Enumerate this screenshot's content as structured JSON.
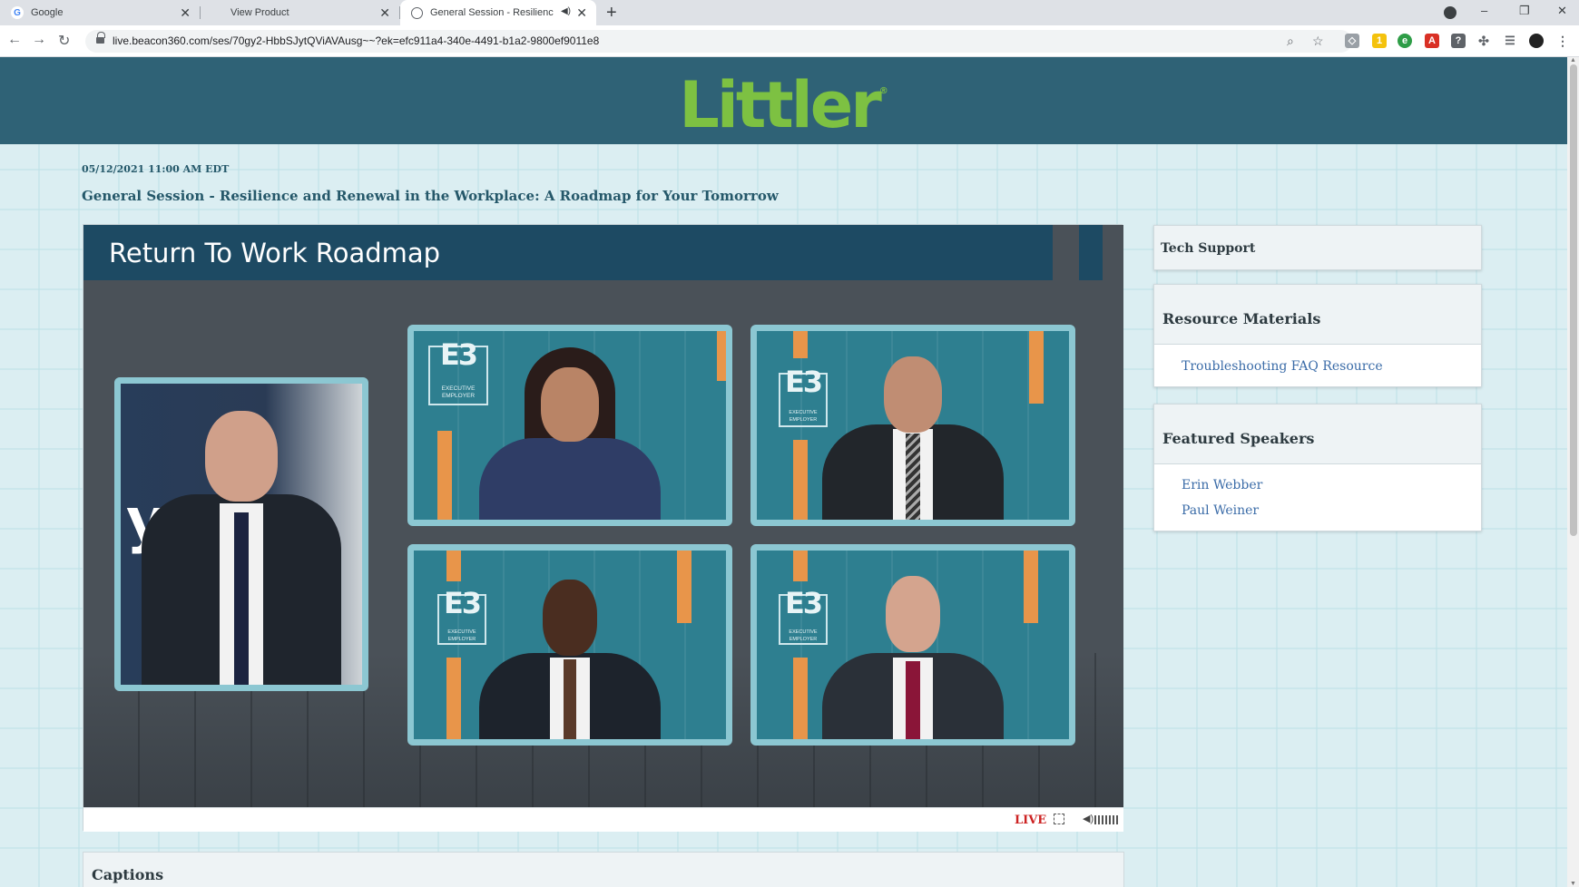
{
  "browser": {
    "tabs": [
      {
        "title": "Google",
        "favicon": "google-g-icon",
        "active": false
      },
      {
        "title": "View Product",
        "favicon": "none",
        "active": false
      },
      {
        "title": "General Session - Resilience",
        "favicon": "globe-icon",
        "active": true,
        "audio": true
      }
    ],
    "new_tab_glyph": "+",
    "url": "live.beacon360.com/ses/70gy2-HbbSJytQViAVAusg~~?ek=efc911a4-340e-4491-b1a2-9800ef9011e8",
    "window_controls": {
      "minimize": "–",
      "restore": "❐",
      "close": "✕"
    }
  },
  "header": {
    "logo_text": "Littler",
    "logo_mark": "®",
    "brand_color": "#7dc142",
    "bar_color": "#2f6276"
  },
  "session": {
    "datetime": "05/12/2021 11:00 AM EDT",
    "title": "General Session - Resilience and Renewal in the Workplace: A Roadmap for Your Tomorrow"
  },
  "video": {
    "slide_title": "Return To Work Roadmap",
    "panel_logo_text": "EXECUTIVE EMPLOYER",
    "host_backdrop_letter": "y",
    "live_label": "LIVE",
    "live_color": "#cc2222"
  },
  "sidebar": {
    "tech_support": {
      "title": "Tech Support"
    },
    "resource_materials": {
      "title": "Resource Materials",
      "links": [
        "Troubleshooting FAQ Resource"
      ]
    },
    "featured_speakers": {
      "title": "Featured Speakers",
      "speakers": [
        "Erin Webber",
        "Paul Weiner"
      ]
    }
  },
  "captions": {
    "title": "Captions"
  }
}
